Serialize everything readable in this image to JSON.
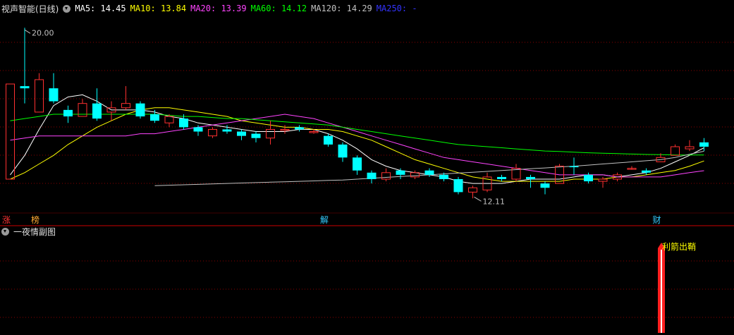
{
  "header": {
    "stock_name": "视声智能(日线)",
    "ma": [
      {
        "label": "MA5: 14.45",
        "color": "#ffffff"
      },
      {
        "label": "MA10: 13.84",
        "color": "#ffff00"
      },
      {
        "label": "MA20: 13.39",
        "color": "#ff44ff"
      },
      {
        "label": "MA60: 14.12",
        "color": "#00ff00"
      },
      {
        "label": "MA120: 14.29",
        "color": "#c0c0c0"
      },
      {
        "label": "MA250: -",
        "color": "#3333ff"
      }
    ]
  },
  "sub_indicator": {
    "name": "一夜情副图",
    "signal_label": "利箭出鞘"
  },
  "price_marks": {
    "high": "20.00",
    "low": "12.11"
  },
  "markers": [
    {
      "text": "涨",
      "color": "#ff3333"
    },
    {
      "text": "榜",
      "color": "#ffaa33"
    },
    {
      "text": "解",
      "color": "#33ccff"
    },
    {
      "text": "财",
      "color": "#33ccff"
    }
  ],
  "colors": {
    "up": "#ff3030",
    "down": "#00ffff",
    "grid": "#8a0000",
    "divider": "#cc0000",
    "signal_bar": "#ff2020"
  },
  "chart_data": {
    "type": "candlestick",
    "y_range": [
      11.5,
      20.5
    ],
    "candles": [
      {
        "o": 13.0,
        "c": 17.4,
        "h": 17.4,
        "l": 13.0,
        "up": true
      },
      {
        "o": 17.3,
        "c": 17.2,
        "h": 20.0,
        "l": 16.5,
        "up": false
      },
      {
        "o": 16.1,
        "c": 17.6,
        "h": 17.9,
        "l": 16.1,
        "up": true
      },
      {
        "o": 17.2,
        "c": 16.6,
        "h": 17.9,
        "l": 16.5,
        "up": false
      },
      {
        "o": 16.2,
        "c": 15.9,
        "h": 16.4,
        "l": 15.6,
        "up": false
      },
      {
        "o": 15.9,
        "c": 16.5,
        "h": 16.7,
        "l": 15.9,
        "up": true
      },
      {
        "o": 16.5,
        "c": 15.8,
        "h": 17.2,
        "l": 15.7,
        "up": false
      },
      {
        "o": 16.1,
        "c": 16.3,
        "h": 16.6,
        "l": 15.7,
        "up": true
      },
      {
        "o": 16.3,
        "c": 16.5,
        "h": 17.3,
        "l": 16.2,
        "up": true
      },
      {
        "o": 16.5,
        "c": 15.9,
        "h": 16.6,
        "l": 15.8,
        "up": false
      },
      {
        "o": 16.0,
        "c": 15.7,
        "h": 16.2,
        "l": 15.6,
        "up": false
      },
      {
        "o": 15.6,
        "c": 15.9,
        "h": 16.0,
        "l": 15.4,
        "up": true
      },
      {
        "o": 15.8,
        "c": 15.4,
        "h": 16.0,
        "l": 15.3,
        "up": false
      },
      {
        "o": 15.4,
        "c": 15.2,
        "h": 15.5,
        "l": 15.0,
        "up": false
      },
      {
        "o": 15.0,
        "c": 15.3,
        "h": 15.4,
        "l": 14.9,
        "up": true
      },
      {
        "o": 15.3,
        "c": 15.2,
        "h": 15.5,
        "l": 15.1,
        "up": false
      },
      {
        "o": 15.2,
        "c": 15.0,
        "h": 15.3,
        "l": 14.8,
        "up": false
      },
      {
        "o": 15.1,
        "c": 14.9,
        "h": 15.2,
        "l": 14.7,
        "up": false
      },
      {
        "o": 14.9,
        "c": 15.3,
        "h": 15.7,
        "l": 14.6,
        "up": true
      },
      {
        "o": 15.3,
        "c": 15.3,
        "h": 15.5,
        "l": 15.1,
        "up": true
      },
      {
        "o": 15.3,
        "c": 15.4,
        "h": 15.5,
        "l": 15.2,
        "up": false
      },
      {
        "o": 15.2,
        "c": 15.2,
        "h": 15.3,
        "l": 15.1,
        "up": true
      },
      {
        "o": 15.0,
        "c": 14.6,
        "h": 15.1,
        "l": 14.5,
        "up": false
      },
      {
        "o": 14.6,
        "c": 14.0,
        "h": 14.7,
        "l": 13.8,
        "up": false
      },
      {
        "o": 14.0,
        "c": 13.4,
        "h": 14.1,
        "l": 13.2,
        "up": false
      },
      {
        "o": 13.3,
        "c": 13.0,
        "h": 13.4,
        "l": 12.8,
        "up": false
      },
      {
        "o": 13.0,
        "c": 13.3,
        "h": 13.5,
        "l": 12.9,
        "up": true
      },
      {
        "o": 13.4,
        "c": 13.2,
        "h": 13.5,
        "l": 13.0,
        "up": false
      },
      {
        "o": 13.1,
        "c": 13.3,
        "h": 13.4,
        "l": 13.0,
        "up": true
      },
      {
        "o": 13.4,
        "c": 13.2,
        "h": 13.5,
        "l": 13.1,
        "up": false
      },
      {
        "o": 13.2,
        "c": 13.0,
        "h": 13.3,
        "l": 12.9,
        "up": false
      },
      {
        "o": 13.0,
        "c": 12.4,
        "h": 13.1,
        "l": 12.3,
        "up": false
      },
      {
        "o": 12.4,
        "c": 12.6,
        "h": 12.7,
        "l": 12.11,
        "up": true
      },
      {
        "o": 12.5,
        "c": 13.1,
        "h": 13.3,
        "l": 12.4,
        "up": true
      },
      {
        "o": 13.1,
        "c": 13.0,
        "h": 13.2,
        "l": 12.9,
        "up": false
      },
      {
        "o": 13.0,
        "c": 13.5,
        "h": 13.7,
        "l": 12.9,
        "up": true
      },
      {
        "o": 13.1,
        "c": 13.0,
        "h": 13.2,
        "l": 12.6,
        "up": false
      },
      {
        "o": 12.8,
        "c": 12.6,
        "h": 12.9,
        "l": 12.3,
        "up": false
      },
      {
        "o": 12.8,
        "c": 13.6,
        "h": 13.7,
        "l": 12.8,
        "up": true
      },
      {
        "o": 13.6,
        "c": 13.6,
        "h": 14.0,
        "l": 13.2,
        "up": false
      },
      {
        "o": 13.2,
        "c": 12.9,
        "h": 13.3,
        "l": 12.8,
        "up": false
      },
      {
        "o": 12.9,
        "c": 13.0,
        "h": 13.1,
        "l": 12.6,
        "up": true
      },
      {
        "o": 13.0,
        "c": 13.2,
        "h": 13.3,
        "l": 12.9,
        "up": true
      },
      {
        "o": 13.5,
        "c": 13.5,
        "h": 13.6,
        "l": 13.5,
        "up": true
      },
      {
        "o": 13.4,
        "c": 13.3,
        "h": 13.5,
        "l": 13.2,
        "up": false
      },
      {
        "o": 13.8,
        "c": 14.0,
        "h": 14.2,
        "l": 13.8,
        "up": true
      },
      {
        "o": 14.1,
        "c": 14.5,
        "h": 14.6,
        "l": 14.1,
        "up": true
      },
      {
        "o": 14.4,
        "c": 14.5,
        "h": 14.8,
        "l": 14.3,
        "up": true
      },
      {
        "o": 14.7,
        "c": 14.5,
        "h": 14.9,
        "l": 14.3,
        "up": false
      }
    ],
    "ma_lines": {
      "MA5": [
        13.2,
        14.1,
        15.3,
        16.4,
        16.8,
        16.9,
        16.6,
        16.2,
        16.2,
        16.2,
        16.1,
        15.9,
        15.8,
        15.6,
        15.5,
        15.4,
        15.3,
        15.2,
        15.2,
        15.2,
        15.3,
        15.3,
        15.1,
        14.8,
        14.4,
        13.9,
        13.6,
        13.4,
        13.3,
        13.2,
        13.1,
        12.9,
        12.8,
        12.8,
        12.8,
        12.9,
        13.0,
        13.0,
        13.0,
        13.1,
        13.2,
        13.2,
        13.1,
        13.2,
        13.3,
        13.5,
        13.8,
        14.1,
        14.45
      ],
      "MA10": [
        13.0,
        13.3,
        13.7,
        14.1,
        14.6,
        15.0,
        15.4,
        15.7,
        16.0,
        16.2,
        16.3,
        16.3,
        16.2,
        16.1,
        16.0,
        15.9,
        15.7,
        15.6,
        15.5,
        15.4,
        15.4,
        15.3,
        15.3,
        15.2,
        15.0,
        14.8,
        14.5,
        14.2,
        13.9,
        13.7,
        13.5,
        13.3,
        13.1,
        13.0,
        12.9,
        12.9,
        12.9,
        12.9,
        12.9,
        13.0,
        13.0,
        13.0,
        13.1,
        13.1,
        13.2,
        13.3,
        13.4,
        13.6,
        13.84
      ],
      "MA20": [
        14.8,
        14.9,
        15.0,
        15.0,
        15.0,
        15.0,
        15.0,
        15.0,
        15.0,
        15.1,
        15.1,
        15.2,
        15.3,
        15.4,
        15.5,
        15.6,
        15.7,
        15.8,
        15.9,
        16.0,
        15.9,
        15.8,
        15.6,
        15.4,
        15.2,
        15.0,
        14.8,
        14.6,
        14.4,
        14.2,
        14.0,
        13.9,
        13.8,
        13.7,
        13.6,
        13.5,
        13.4,
        13.3,
        13.2,
        13.2,
        13.2,
        13.2,
        13.1,
        13.1,
        13.1,
        13.1,
        13.2,
        13.3,
        13.39
      ],
      "MA60": [
        15.7,
        15.8,
        15.9,
        16.0,
        16.0,
        16.0,
        16.0,
        16.0,
        16.0,
        16.0,
        16.0,
        15.95,
        15.9,
        15.9,
        15.85,
        15.8,
        15.8,
        15.75,
        15.7,
        15.65,
        15.6,
        15.55,
        15.5,
        15.4,
        15.3,
        15.2,
        15.1,
        15.0,
        14.9,
        14.8,
        14.7,
        14.6,
        14.55,
        14.5,
        14.45,
        14.4,
        14.35,
        14.3,
        14.28,
        14.25,
        14.22,
        14.2,
        14.18,
        14.16,
        14.14,
        14.13,
        14.12,
        14.12,
        14.12
      ],
      "MA120": [
        null,
        null,
        null,
        null,
        null,
        null,
        null,
        null,
        null,
        null,
        12.7,
        12.72,
        12.74,
        12.76,
        12.78,
        12.8,
        12.82,
        12.84,
        12.86,
        12.88,
        12.9,
        12.92,
        12.94,
        12.96,
        13.0,
        13.04,
        13.08,
        13.12,
        13.16,
        13.2,
        13.24,
        13.28,
        13.32,
        13.36,
        13.4,
        13.44,
        13.48,
        13.52,
        13.56,
        13.6,
        13.65,
        13.7,
        13.75,
        13.8,
        13.85,
        13.9,
        14.0,
        14.15,
        14.29
      ]
    },
    "signal": {
      "index": 45,
      "value": 1
    }
  }
}
